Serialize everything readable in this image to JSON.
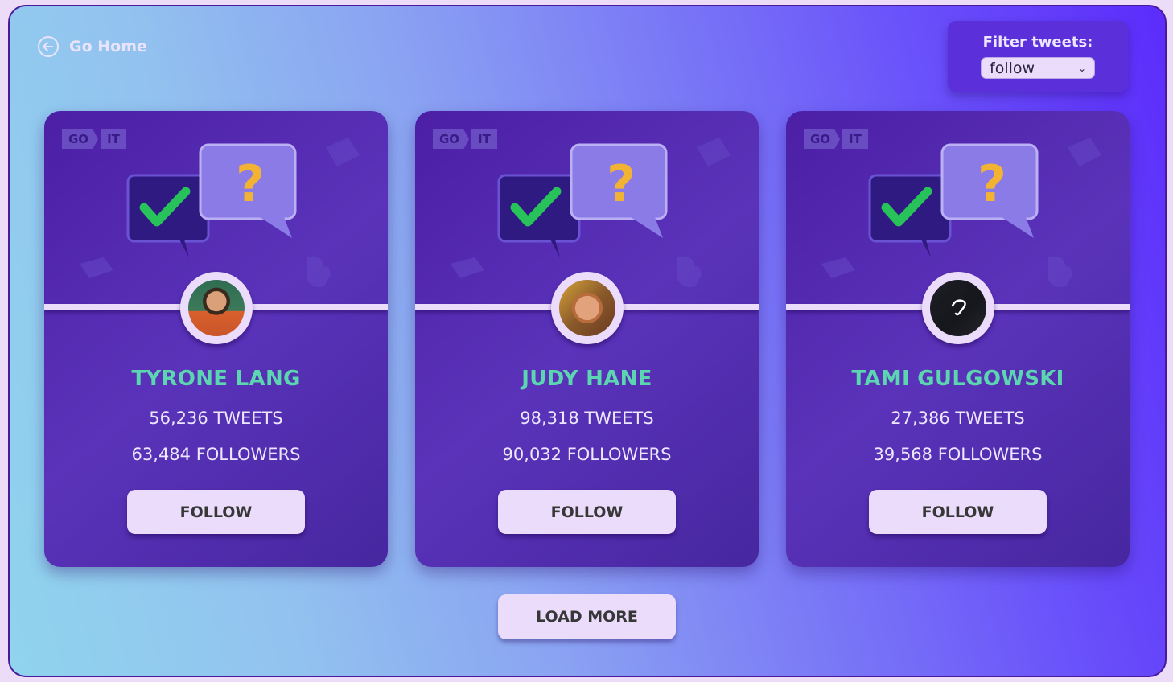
{
  "nav": {
    "go_home_label": "Go Home"
  },
  "filter": {
    "label": "Filter tweets:",
    "selected": "follow"
  },
  "cards": [
    {
      "logo_left": "GO",
      "logo_right": "IT",
      "name": "TYRONE LANG",
      "tweets": "56,236 TWEETS",
      "followers": "63,484 FOLLOWERS",
      "button_label": "FOLLOW"
    },
    {
      "logo_left": "GO",
      "logo_right": "IT",
      "name": "JUDY HANE",
      "tweets": "98,318 TWEETS",
      "followers": "90,032 FOLLOWERS",
      "button_label": "FOLLOW"
    },
    {
      "logo_left": "GO",
      "logo_right": "IT",
      "name": "TAMI GULGOWSKI",
      "tweets": "27,386 TWEETS",
      "followers": "39,568 FOLLOWERS",
      "button_label": "FOLLOW"
    }
  ],
  "load_more_label": "LOAD MORE",
  "colors": {
    "accent_name": "#5cd6b0",
    "card_bg": "#4c1fa5",
    "button_bg": "#ebdcfb"
  }
}
